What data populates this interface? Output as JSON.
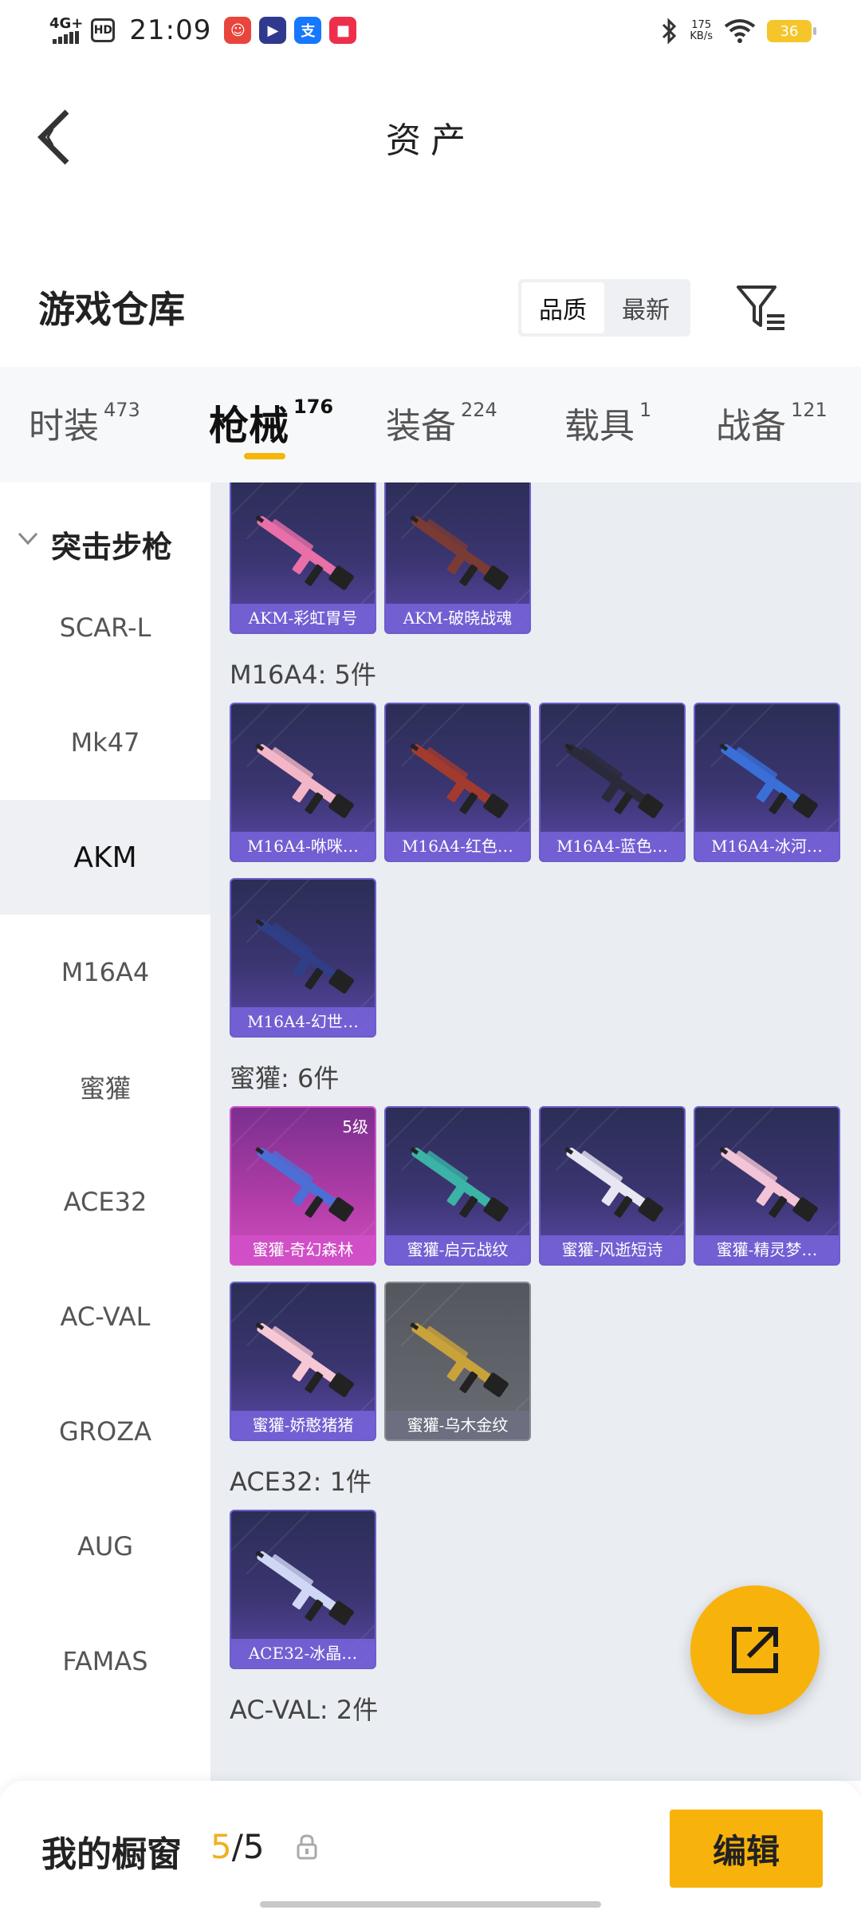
{
  "status_bar": {
    "network": "4G+",
    "hd": "HD",
    "time": "21:09",
    "apps": [
      {
        "name": "app-red-icon",
        "glyph": "☺",
        "color": "#e8453c"
      },
      {
        "name": "play-icon",
        "glyph": "▶",
        "color": "#2f3a8f"
      },
      {
        "name": "alipay-icon",
        "glyph": "支",
        "color": "#1677ff"
      },
      {
        "name": "app-pink-icon",
        "glyph": "■",
        "color": "#ee2f4c"
      }
    ],
    "speed_value": "175",
    "speed_unit": "KB/s",
    "battery": "36"
  },
  "header": {
    "title": "资产"
  },
  "warehouse": {
    "title": "游戏仓库",
    "sort_options": [
      "品质",
      "最新"
    ],
    "active_sort": "品质"
  },
  "tabs": [
    {
      "label": "时装",
      "count": "473"
    },
    {
      "label": "枪械",
      "count": "176"
    },
    {
      "label": "装备",
      "count": "224"
    },
    {
      "label": "载具",
      "count": "1"
    },
    {
      "label": "战备",
      "count": "121"
    }
  ],
  "sidebar": {
    "category": "突击步枪",
    "items": [
      "SCAR-L",
      "Mk47",
      "AKM",
      "M16A4",
      "蜜獾",
      "ACE32",
      "AC-VAL",
      "GROZA",
      "AUG",
      "FAMAS"
    ],
    "active": "AKM"
  },
  "groups": [
    {
      "title": "",
      "items": [
        {
          "label": "AKM-彩虹胃号",
          "style": "blue",
          "gun": "#e86fa8"
        },
        {
          "label": "AKM-破晓战魂",
          "style": "blue",
          "gun": "#7a3b35"
        }
      ]
    },
    {
      "title": "M16A4: 5件",
      "items": [
        {
          "label": "M16A4-咻咪…",
          "style": "blue",
          "gun": "#f3b6c6"
        },
        {
          "label": "M16A4-红色…",
          "style": "blue",
          "gun": "#a33a2e"
        },
        {
          "label": "M16A4-蓝色…",
          "style": "blue",
          "gun": "#2a2a3a"
        },
        {
          "label": "M16A4-冰河…",
          "style": "blue",
          "gun": "#3a6fd8"
        },
        {
          "label": "M16A4-幻世…",
          "style": "blue",
          "gun": "#2f3e86"
        }
      ]
    },
    {
      "title": "蜜獾: 6件",
      "items": [
        {
          "label": "蜜獾-奇幻森林",
          "style": "pink",
          "gun": "#4c6fd6",
          "level": "5级"
        },
        {
          "label": "蜜獾-启元战纹",
          "style": "blue",
          "gun": "#3bb3a6"
        },
        {
          "label": "蜜獾-风逝短诗",
          "style": "blue",
          "gun": "#e8e6f3"
        },
        {
          "label": "蜜獾-精灵梦…",
          "style": "blue",
          "gun": "#f2c4d6"
        },
        {
          "label": "蜜獾-娇憨猪猪",
          "style": "blue",
          "gun": "#f6c7d4"
        },
        {
          "label": "蜜獾-乌木金纹",
          "style": "gray",
          "gun": "#c9a23a"
        }
      ]
    },
    {
      "title": "ACE32: 1件",
      "items": [
        {
          "label": "ACE32-冰晶…",
          "style": "blue",
          "gun": "#cfd7f4"
        }
      ]
    },
    {
      "title": "AC-VAL: 2件",
      "items": []
    }
  ],
  "bottom": {
    "title": "我的橱窗",
    "current": "5",
    "total": "/5",
    "edit_label": "编辑"
  }
}
